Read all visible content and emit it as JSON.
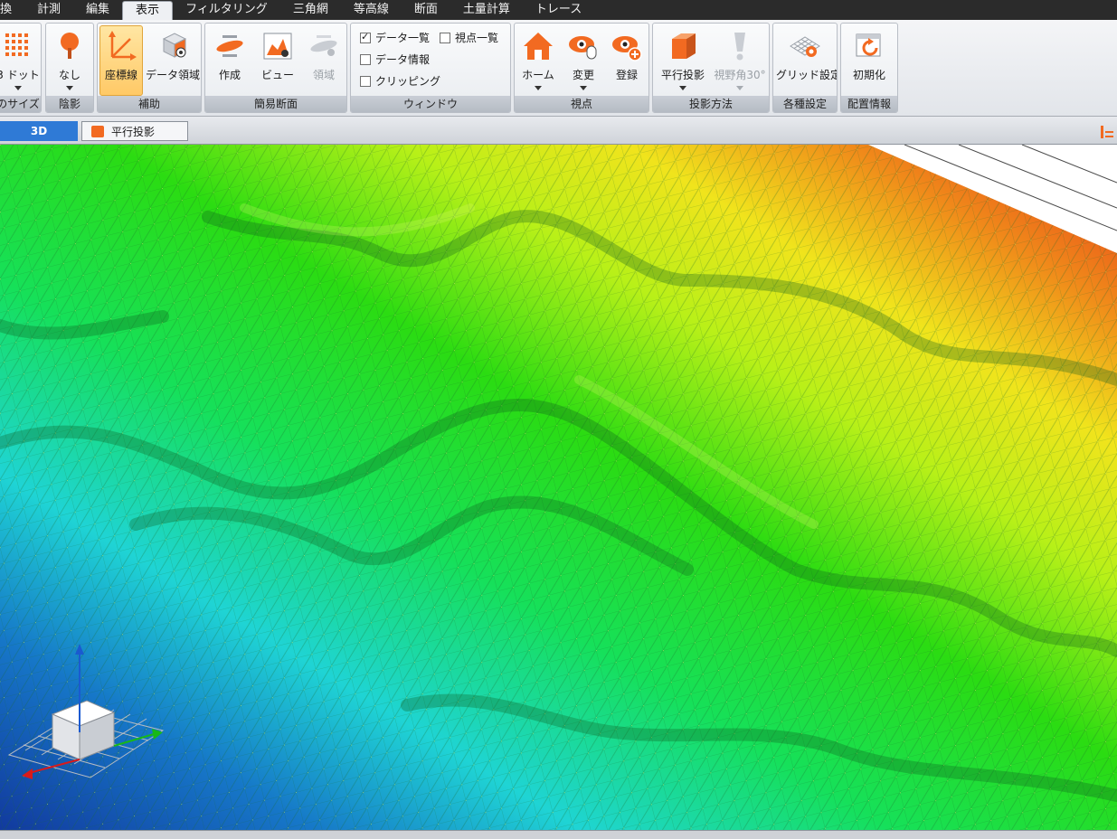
{
  "menu": {
    "items": [
      {
        "label": "換"
      },
      {
        "label": "計測"
      },
      {
        "label": "編集"
      },
      {
        "label": "表示"
      },
      {
        "label": "フィルタリング"
      },
      {
        "label": "三角網"
      },
      {
        "label": "等高線"
      },
      {
        "label": "断面"
      },
      {
        "label": "土量計算"
      },
      {
        "label": "トレース"
      }
    ],
    "active": "表示"
  },
  "ribbon": {
    "groups": {
      "size": {
        "label": "のサイズ",
        "button": "3 ドット"
      },
      "shadow": {
        "label": "陰影",
        "button": "なし"
      },
      "assist": {
        "label": "補助",
        "axis_button": "座標線",
        "data_area_button": "データ領域"
      },
      "section": {
        "label": "簡易断面",
        "create": "作成",
        "view": "ビュー",
        "area": "領域"
      },
      "window": {
        "label": "ウィンドウ",
        "data_list": "データ一覧",
        "viewpoint_list": "視点一覧",
        "data_info": "データ情報",
        "clipping": "クリッピング"
      },
      "viewpoint": {
        "label": "視点",
        "home": "ホーム",
        "change": "変更",
        "register": "登録"
      },
      "projection": {
        "label": "投影方法",
        "parallel": "平行投影",
        "fov": "視野角30°"
      },
      "settings": {
        "label": "各種設定",
        "grid": "グリッド設定"
      },
      "layout": {
        "label": "配置情報",
        "reset": "初期化"
      }
    },
    "checkboxes": {
      "data_list": true,
      "viewpoint_list": false,
      "data_info": false,
      "clipping": false
    }
  },
  "tabs": {
    "view_tab": "3D",
    "projection_tab": "平行投影"
  },
  "colors": {
    "accent_orange": "#f26a21",
    "tab_blue": "#2f7ad6",
    "menubar": "#2b2b2b"
  }
}
